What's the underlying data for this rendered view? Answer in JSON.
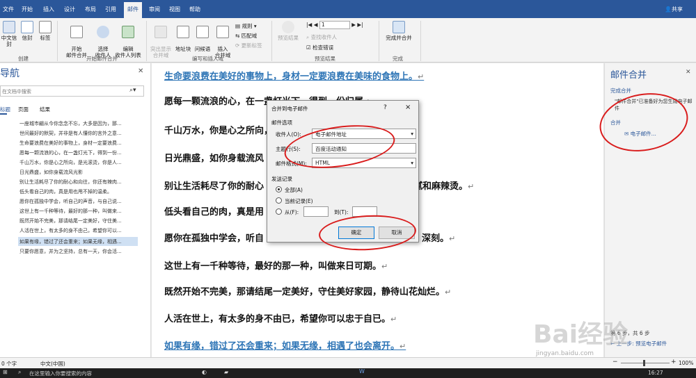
{
  "ribbon": {
    "tabs": [
      "文件",
      "开始",
      "插入",
      "设计",
      "布局",
      "引用",
      "邮件",
      "审阅",
      "视图",
      "帮助"
    ],
    "active_tab": "邮件",
    "share_label": "共享",
    "groups": {
      "create": {
        "label": "创建",
        "buttons": [
          "中文信封",
          "信封",
          "标签"
        ]
      },
      "start": {
        "label": "开始邮件合并",
        "buttons": [
          "开始\n邮件合并",
          "选择\n收件人",
          "编辑\n收件人列表"
        ]
      },
      "fields": {
        "label": "编写和插入域",
        "buttons": [
          "突出显示\n合并域",
          "地址块",
          "问候语",
          "插入\n合并域"
        ],
        "small": [
          "规则",
          "匹配域",
          "更新标签"
        ]
      },
      "preview": {
        "label": "预览结果",
        "buttons": [
          "预览结果"
        ],
        "small": [
          "查找收件人",
          "检查错误"
        ],
        "record_value": "1"
      },
      "finish": {
        "label": "完成",
        "buttons": [
          "完成并合并"
        ]
      }
    }
  },
  "nav": {
    "title": "导航",
    "search_placeholder": "在文档中搜索",
    "tabs": [
      "标题",
      "页面",
      "结果"
    ],
    "items": [
      "一座城市翩从今你念念不忘，大多是因为，那...",
      "世间最好的默契，并非是有人懂你的言外之意...",
      "生命要浪费在美好的事物上，身材一定要浪费...",
      "愿每一颗流浪的心，在一盏灯光下，得到一份...",
      "千山万水，你是心之所向，是光滚烫，你是人...",
      "日光鼎盛，如你身载流风光影",
      "别让生活耗尽了你的耐心和向往，你还有辣肉...",
      "低头看自己的肉，真是用也甩不掉的温柔。",
      "愿你在孤独中学会，听自己的声音，与自己说...",
      "这世上有一千种等待，最好的那一种，叫做来...",
      "既然开始不完美，那请结尾一定美好，守住美...",
      "人活在世上，有太多的身不由己，希望你可以...",
      "如果有缘，错过了还会重来；如果无缘，相遇...",
      "只要你愿意，并为之坚持，总有一天，你会活..."
    ]
  },
  "document": {
    "lines": [
      "生命要浪费在美好的事物上，身材一定要浪费在美味的食物上。",
      "愿每一颗流浪的心，在一盏灯光下，得到一份归属",
      "千山万水，你是心之所向，",
      "日光鼎盛，如你身载流风",
      "别让生活耗尽了你的耐心",
      "低头看自己的肉，真是用",
      "愿你在孤独中学会，听自",
      "这世上有一千种等待，最好的那一种，叫做来日可期。",
      "既然开始不完美，那请结尾一定美好，守住美好家园，静待山花灿烂。",
      "人活在世上，有太多的身不由已，希望你可以忠于自已。",
      "如果有缘，错过了还会重来；如果无缘，相遇了也会离开。"
    ],
    "line_tails": {
      "4": "腻和麻辣烫。",
      "6": "深刻。"
    },
    "paragraph_mark": "↵"
  },
  "dialog": {
    "title": "合并到电子邮件",
    "help": "?",
    "close": "×",
    "section_options": "邮件选项",
    "recipient_label": "收件人(O):",
    "recipient_value": "电子邮件地址",
    "subject_label": "主题行(S):",
    "subject_value": "百度活动通知",
    "format_label": "邮件格式(M):",
    "format_value": "HTML",
    "section_records": "发送记录",
    "radio_all": "全部(A)",
    "radio_current": "当前记录(E)",
    "radio_from": "从(F):",
    "to_label": "到(T):",
    "ok": "确定",
    "cancel": "取消"
  },
  "merge_pane": {
    "title": "邮件合并",
    "section_complete": "完成合并",
    "complete_text": "\"邮件合并\"已准备好为您生成电子邮件",
    "section_merge": "合并",
    "email_link": "电子邮件...",
    "step_label": "第 6 步，共 6 步",
    "prev_link": "上一步: 预览电子邮件"
  },
  "status": {
    "words": "0 个字",
    "lang": "中文(中国)",
    "zoom": "100%"
  },
  "taskbar": {
    "search_placeholder": "在这里输入你要搜索的内容",
    "time": "16:27"
  },
  "watermark": {
    "text": "Bai经验",
    "sub": "jingyan.baidu.com"
  },
  "colors": {
    "word_blue": "#2b579a",
    "annotation_red": "#d91c1c",
    "link_blue": "#2e75b6"
  }
}
